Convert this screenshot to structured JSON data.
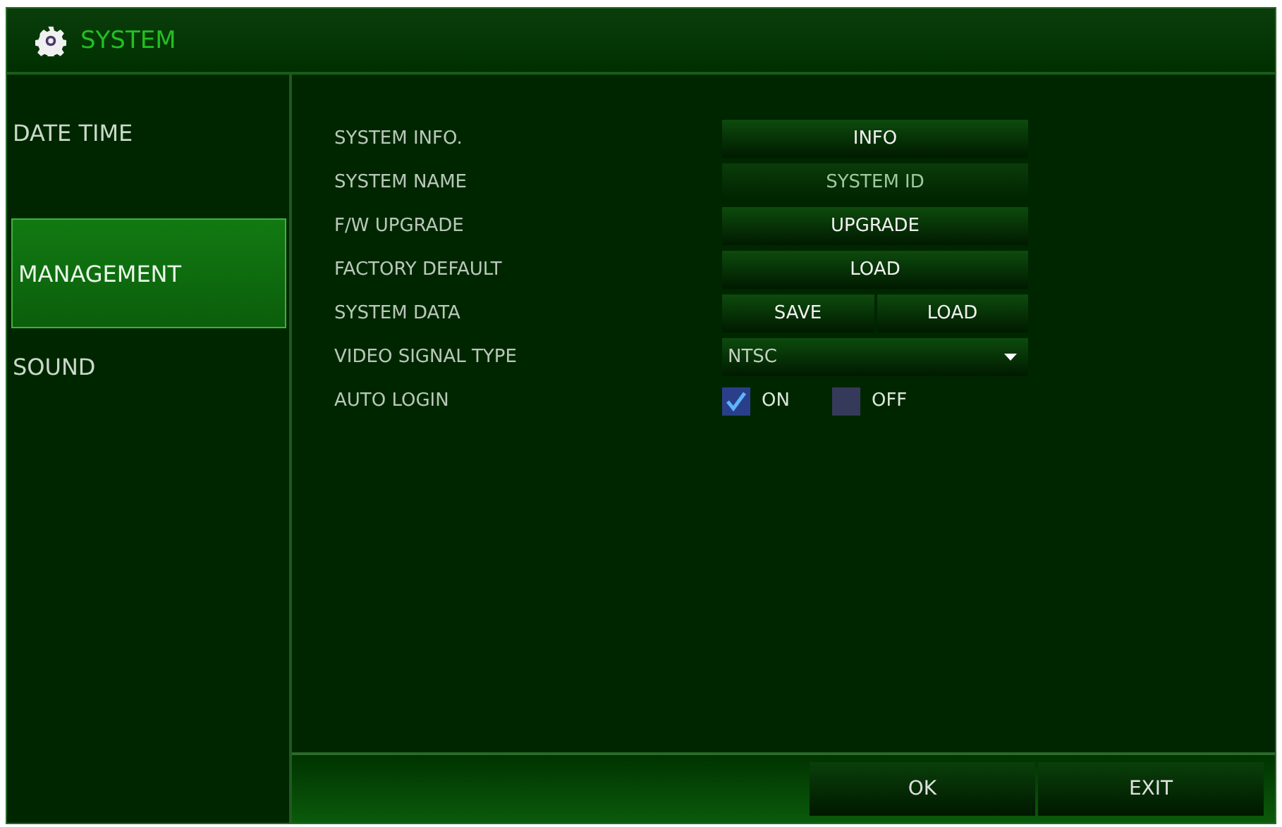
{
  "window": {
    "title": "SYSTEM"
  },
  "sidebar": {
    "items": [
      {
        "label": "DATE TIME",
        "selected": false
      },
      {
        "label": "MANAGEMENT",
        "selected": true
      },
      {
        "label": "SOUND",
        "selected": false
      }
    ]
  },
  "settings": [
    {
      "label": "SYSTEM INFO.",
      "kind": "button",
      "buttons": [
        "INFO"
      ]
    },
    {
      "label": "SYSTEM NAME",
      "kind": "field",
      "value": "SYSTEM ID"
    },
    {
      "label": "F/W UPGRADE",
      "kind": "button",
      "buttons": [
        "UPGRADE"
      ]
    },
    {
      "label": "FACTORY DEFAULT",
      "kind": "button",
      "buttons": [
        "LOAD"
      ]
    },
    {
      "label": "SYSTEM DATA",
      "kind": "button",
      "buttons": [
        "SAVE",
        "LOAD"
      ]
    },
    {
      "label": "VIDEO SIGNAL TYPE",
      "kind": "select",
      "value": "NTSC"
    },
    {
      "label": "AUTO LOGIN",
      "kind": "checks",
      "options": [
        {
          "label": "ON",
          "checked": true
        },
        {
          "label": "OFF",
          "checked": false
        }
      ]
    }
  ],
  "footer": {
    "buttons": [
      "OK",
      "EXIT"
    ]
  }
}
